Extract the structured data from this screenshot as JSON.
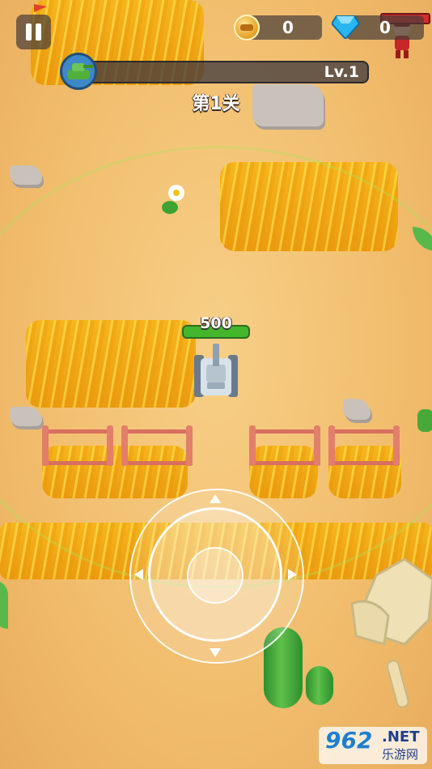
{
  "hud": {
    "coins": "0",
    "gems": "0",
    "level": "Lv.1",
    "stage": "第1关"
  },
  "player": {
    "health": "500"
  },
  "watermark": {
    "brand": "962",
    "suffix": ".NET",
    "site": "乐游网"
  },
  "colors": {
    "sand": "#f2bd6e",
    "wheat": "#f4ac17",
    "health_bar": "#43b62b",
    "level_bar": "#3c373c",
    "gem": "#27b6f0",
    "coin": "#e29a1c"
  },
  "icons": [
    "pause-icon",
    "coin-icon",
    "gem-icon",
    "tank-level-icon",
    "tank-player",
    "joystick"
  ]
}
